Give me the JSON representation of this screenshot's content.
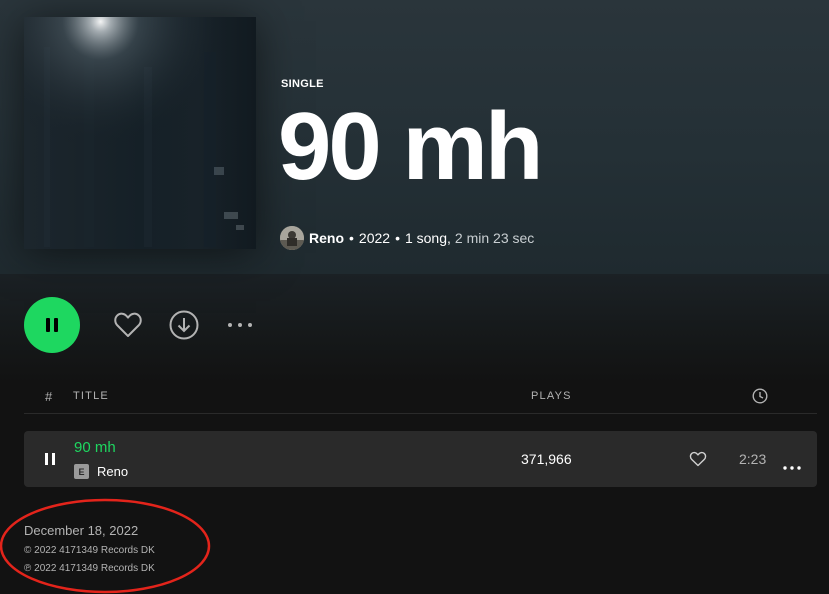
{
  "album": {
    "type_label": "SINGLE",
    "title": "90 mh",
    "artist": "Reno",
    "year": "2022",
    "song_count": "1 song,",
    "duration": "2 min 23 sec"
  },
  "actions": {
    "play_state": "pause-icon",
    "icons": [
      "heart-icon",
      "download-icon",
      "more-icon"
    ]
  },
  "table": {
    "header": {
      "number": "#",
      "title": "TITLE",
      "plays": "PLAYS",
      "duration_icon": "clock-icon"
    },
    "tracks": [
      {
        "title": "90 mh",
        "explicit_badge": "E",
        "artist": "Reno",
        "plays": "371,966",
        "duration": "2:23"
      }
    ]
  },
  "release": {
    "date": "December 18, 2022",
    "copyright": "© 2022 4171349 Records DK",
    "phonographic": "℗ 2022 4171349 Records DK"
  },
  "colors": {
    "accent": "#1ed760",
    "annotation": "#e3241b",
    "background": "#121212",
    "header": "#243036"
  }
}
